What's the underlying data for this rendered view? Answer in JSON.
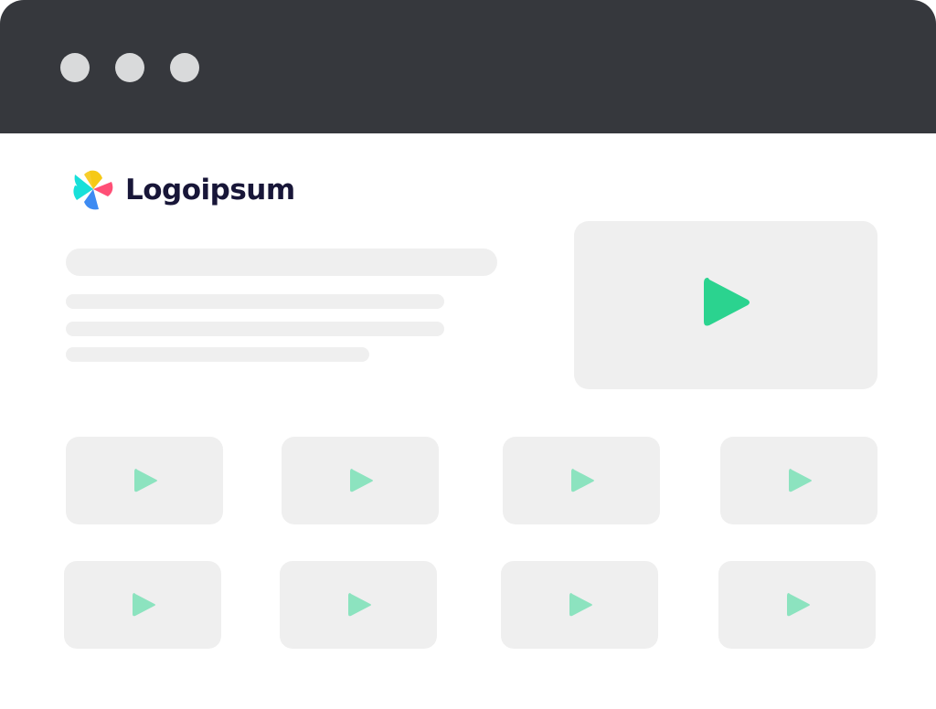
{
  "window": {
    "controls": [
      "window-dot",
      "window-dot",
      "window-dot"
    ]
  },
  "brand": {
    "name": "Logoipsum",
    "colors": {
      "text": "#181638",
      "petal_teal": "#18e0d9",
      "petal_yellow": "#f6c915",
      "petal_pink": "#ff4f76",
      "petal_blue": "#3d8bf2"
    }
  },
  "hero": {
    "icon": "play-icon",
    "accent": "#2bd38f"
  },
  "thumbnails": {
    "icon": "play-icon",
    "accent": "#8ce3bf",
    "count": 8
  },
  "colors": {
    "titlebar": "#36383d",
    "placeholder": "#efefef",
    "background": "#ffffff"
  }
}
